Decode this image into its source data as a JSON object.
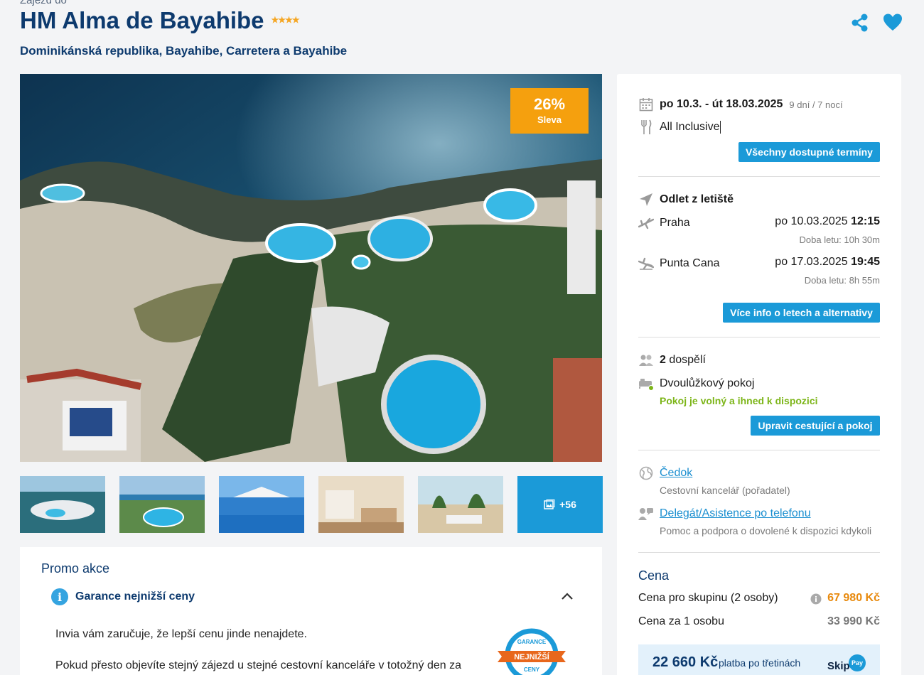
{
  "header": {
    "breadcrumb": "Zájezd do",
    "title": "HM Alma de Bayahibe",
    "stars": "★★★★",
    "location": "Dominikánská republika, Bayahibe, Carretera a Bayahibe"
  },
  "hero": {
    "discount_pct": "26%",
    "discount_label": "Sleva"
  },
  "gallery": {
    "more_label": "+56"
  },
  "promo": {
    "title": "Promo akce",
    "item_title": "Garance nejnižší ceny",
    "p1": "Invia vám zaručuje, že lepší cenu jinde nenajdete.",
    "p2": "Pokud přesto objevíte stejný zájezd u stejné cestovní kanceláře v totožný den za",
    "badge_top": "GARANCE",
    "badge_mid": "NEJNIŽŠÍ",
    "badge_bot": "CENY"
  },
  "booking": {
    "dates": "po 10.3. - út 18.03.2025",
    "duration": "9 dní / 7 nocí",
    "board": "All Inclusive",
    "all_dates_btn": "Všechny dostupné termíny",
    "flight_heading": "Odlet z letiště",
    "outbound_city": "Praha",
    "outbound_date": "po 10.03.2025",
    "outbound_time": "12:15",
    "outbound_duration": "Doba letu: 10h 30m",
    "return_city": "Punta Cana",
    "return_date": "po 17.03.2025",
    "return_time": "19:45",
    "return_duration": "Doba letu: 8h 55m",
    "flights_btn": "Více info o letech a alternativy",
    "travelers_count": "2",
    "travelers_label": "dospělí",
    "room": "Dvoulůžkový pokoj",
    "room_status": "Pokoj je volný a ihned k dispozici",
    "edit_btn": "Upravit cestující a pokoj",
    "agency_name": "Čedok",
    "agency_desc": "Cestovní kancelář (pořadatel)",
    "support_name": "Delegát/Asistence po telefonu",
    "support_desc": "Pomoc a podpora o dovolené k dispozici kdykoli",
    "price_heading": "Cena",
    "group_label": "Cena pro skupinu (2 osoby)",
    "group_price": "67 980 Kč",
    "person_label": "Cena za 1 osobu",
    "person_price": "33 990 Kč",
    "installment_price": "22 660 Kč",
    "installment_label": "platba po třetinách",
    "skippay_skip": "Skip",
    "skippay_pay": "Pay"
  },
  "colors": {
    "brand": "#0d3a6e",
    "accent": "#1b9ad8",
    "discount": "#f5a00e",
    "price": "#e8890c",
    "ok": "#7cb518"
  }
}
